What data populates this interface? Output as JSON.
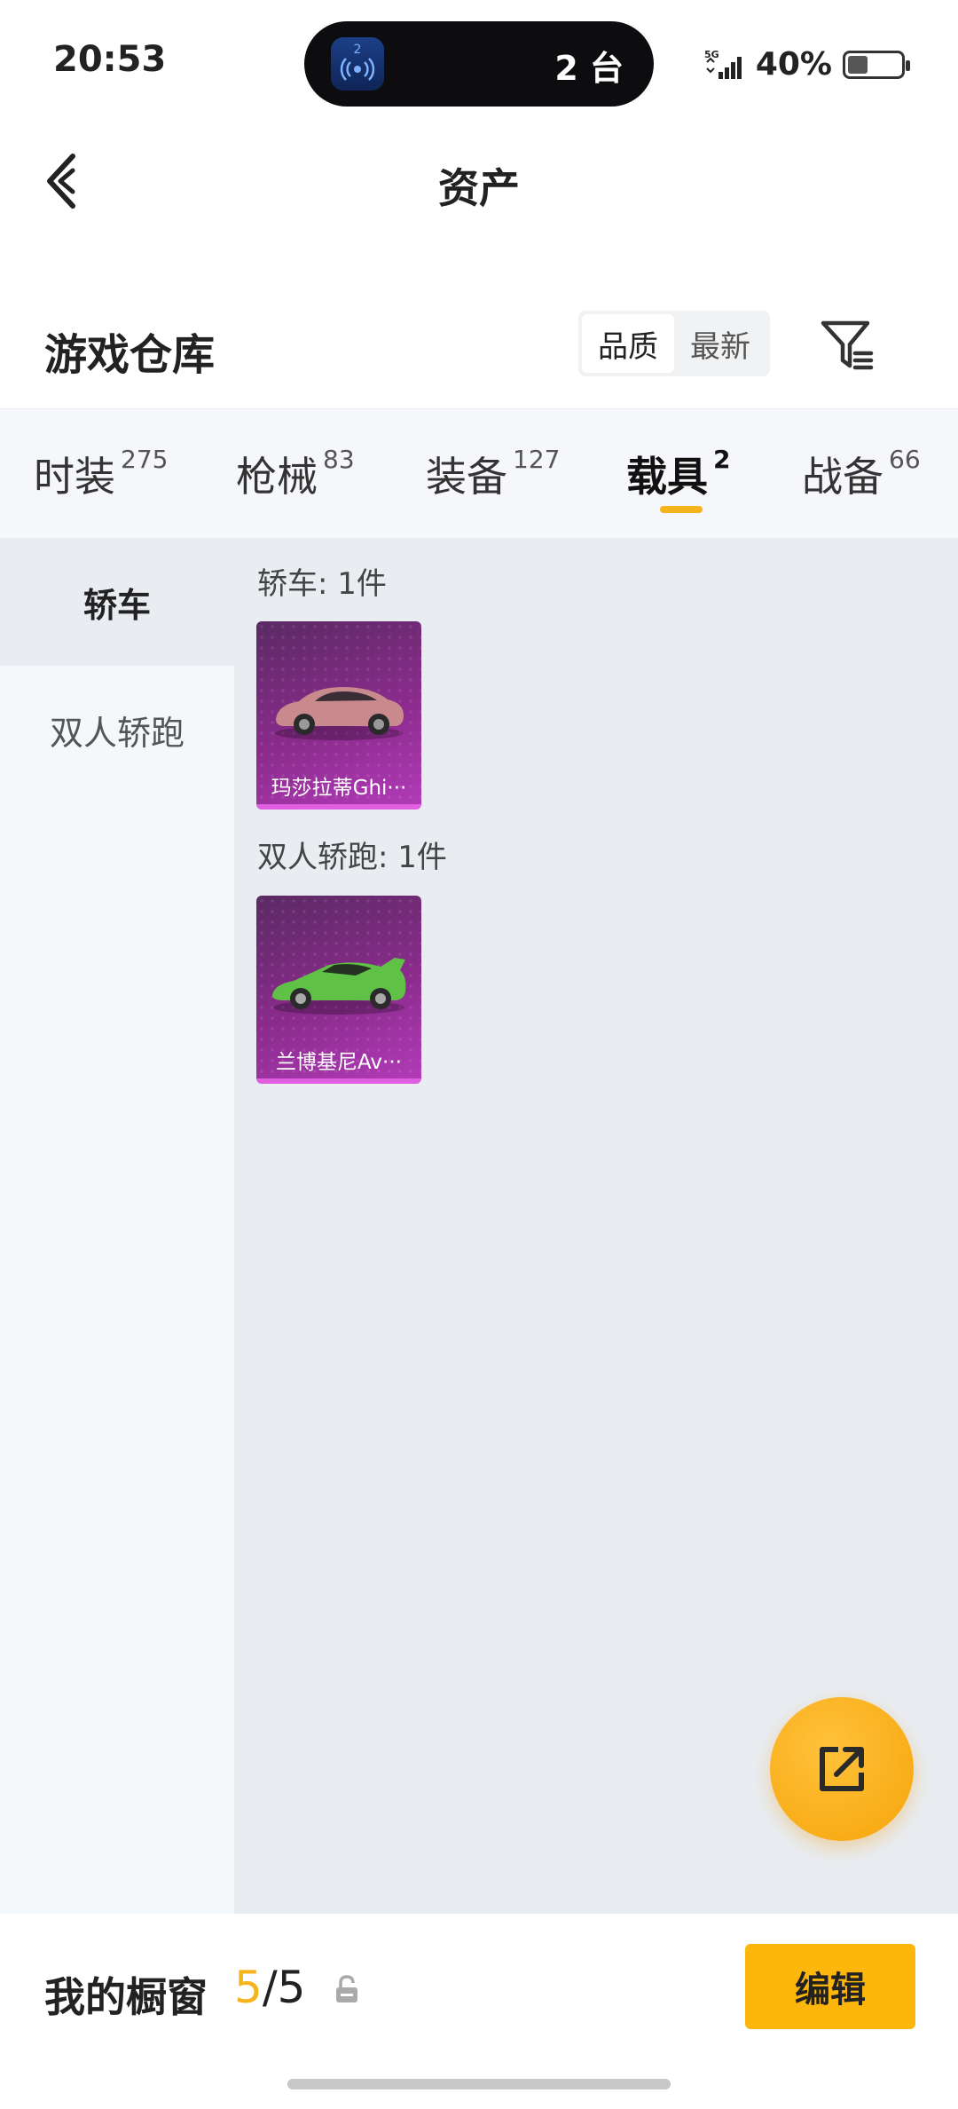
{
  "status_bar": {
    "time": "20:53",
    "island_badge": "2",
    "island_count": "2 台",
    "network": "5G",
    "battery_pct": "40%",
    "battery_level": 0.4
  },
  "header": {
    "title": "资产"
  },
  "warehouse": {
    "title": "游戏仓库",
    "sort_options": [
      "品质",
      "最新"
    ],
    "active_sort": 0
  },
  "tabs": [
    {
      "label": "时装",
      "count": "275"
    },
    {
      "label": "枪械",
      "count": "83"
    },
    {
      "label": "装备",
      "count": "127"
    },
    {
      "label": "载具",
      "count": "2",
      "active": true
    },
    {
      "label": "战备",
      "count": "66"
    }
  ],
  "side_nav": [
    {
      "label": "轿车",
      "active": true
    },
    {
      "label": "双人轿跑"
    }
  ],
  "sections": [
    {
      "label": "轿车: 1件",
      "items": [
        {
          "name": "玛莎拉蒂Ghi···",
          "car_color": "#c98a8e"
        }
      ]
    },
    {
      "label": "双人轿跑: 1件",
      "items": [
        {
          "name": "兰博基尼Av···",
          "car_color": "#5fc246"
        }
      ]
    }
  ],
  "bottom_bar": {
    "showcase_label": "我的橱窗",
    "current": "5",
    "sep": "/",
    "total": "5",
    "edit_label": "编辑"
  },
  "icons": {
    "back": "back-arrow-icon",
    "filter": "filter-icon",
    "share": "share-external-icon",
    "lock": "lock-icon",
    "accent": "#f5b31c"
  }
}
